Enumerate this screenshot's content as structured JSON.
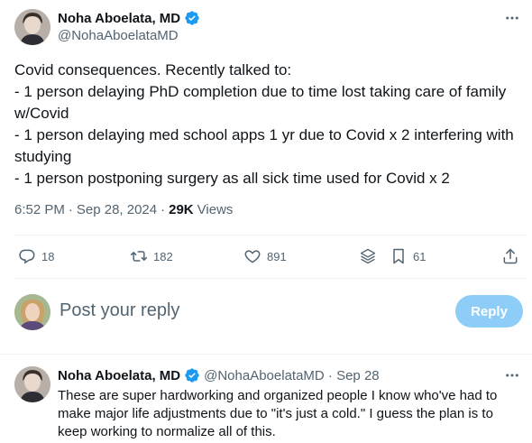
{
  "tweet": {
    "author_name": "Noha Aboelata, MD",
    "author_handle": "@NohaAboelataMD",
    "text_lines": [
      "Covid consequences. Recently talked to:",
      "- 1 person delaying PhD completion due to time lost taking care of family w/Covid",
      "- 1 person delaying med school apps 1 yr due to Covid x 2 interfering with studying",
      "- 1 person postponing surgery as all sick time used for Covid x 2"
    ],
    "time": "6:52 PM",
    "date": "Sep 28, 2024",
    "separator": "·",
    "views_count": "29K",
    "views_label": "Views"
  },
  "actions": {
    "replies": "18",
    "reposts": "182",
    "likes": "891",
    "bookmarks": "61"
  },
  "composer": {
    "placeholder": "Post your reply",
    "reply_label": "Reply"
  },
  "reply": {
    "author_name": "Noha Aboelata, MD",
    "meta": "@NohaAboelataMD · Sep 28",
    "text": "These are super hardworking and organized people I know who've had to make major life adjustments due to \"it's just a cold.\" I guess the plan is to keep working to normalize all of this."
  },
  "colors": {
    "verified": "#1d9bf0",
    "secondary_text": "#536471",
    "reply_button": "#8ecdf7"
  },
  "icons": [
    "more-icon",
    "verified-badge-icon",
    "reply-icon",
    "repost-icon",
    "like-icon",
    "stack-icon",
    "bookmark-icon",
    "share-icon"
  ]
}
